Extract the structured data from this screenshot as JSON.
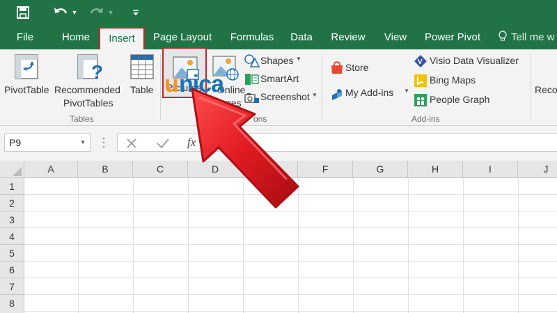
{
  "qat": {
    "save_icon": "save-icon",
    "undo_icon": "undo-icon",
    "redo_icon": "redo-icon",
    "customize_icon": "customize-qat-icon"
  },
  "tabs": {
    "file": "File",
    "home": "Home",
    "insert": "Insert",
    "page_layout": "Page Layout",
    "formulas": "Formulas",
    "data": "Data",
    "review": "Review",
    "view": "View",
    "power_pivot": "Power Pivot",
    "tell_me": "Tell me w"
  },
  "ribbon": {
    "tables": {
      "pivot_table": "PivotTable",
      "recommended_pivot_tables_1": "Recommended",
      "recommended_pivot_tables_2": "PivotTables",
      "table": "Table",
      "group_label": "Tables"
    },
    "illustrations": {
      "pictures": "Pictures",
      "online_pictures_1": "Online",
      "online_pictures_2": "Pictures",
      "shapes": "Shapes",
      "smartart": "SmartArt",
      "screenshot": "Screenshot",
      "group_label_partial": "ons"
    },
    "addins": {
      "store": "Store",
      "my_addins": "My Add-ins",
      "visio": "Visio Data Visualizer",
      "bing_maps": "Bing Maps",
      "people_graph": "People Graph",
      "group_label": "Add-ins"
    },
    "recommended_charts_partial": "Reco"
  },
  "formula_bar": {
    "name_box_value": "P9",
    "fx_label": "fx"
  },
  "grid": {
    "columns": [
      "A",
      "B",
      "C",
      "D",
      "E",
      "F",
      "G",
      "H",
      "I",
      "J"
    ],
    "rows": [
      "1",
      "2",
      "3",
      "4",
      "5",
      "6",
      "7",
      "8"
    ]
  },
  "watermark": {
    "text_u": "u",
    "text_rest": "nica"
  },
  "colors": {
    "excel_green": "#217346",
    "highlight_red": "#c0282d",
    "arrow_red": "#e01b22",
    "watermark_orange": "#f7931d",
    "watermark_blue": "#1a75bb"
  }
}
